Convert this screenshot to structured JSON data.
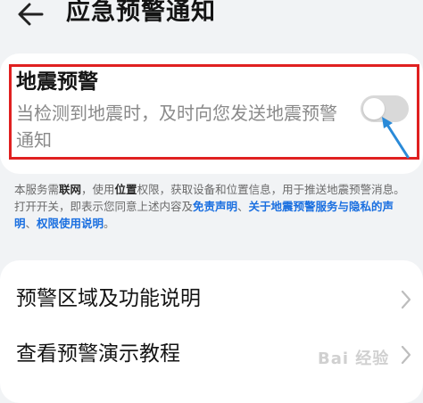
{
  "header": {
    "title": "应急预警通知",
    "back_icon": "arrow-left-icon"
  },
  "earthquake": {
    "title": "地震预警",
    "description": "当检测到地震时，及时向您发送地震预警通知",
    "toggle_on": false
  },
  "notice": {
    "t1": "本服务需",
    "b1": "联网",
    "t2": "，使用",
    "b2": "位置",
    "t3": "权限，获取设备和位置信息，用于推送地震预警消息。打开开关，即表示您同意上述内容及",
    "l1": "免责声明",
    "t4": "、",
    "l2": "关于地震预警服务与隐私的声明",
    "t5": "、",
    "l3": "权限使用说明",
    "t6": "。"
  },
  "menu": {
    "items": [
      {
        "label": "预警区域及功能说明"
      },
      {
        "label": "查看预警演示教程"
      }
    ]
  },
  "watermark": "Bai 经验",
  "colors": {
    "background": "#f1f3f5",
    "card": "#ffffff",
    "highlight": "#e02020",
    "link": "#1a6fe0",
    "annotation_arrow": "#2a8ad8",
    "toggle_off": "#d9d9d9"
  }
}
